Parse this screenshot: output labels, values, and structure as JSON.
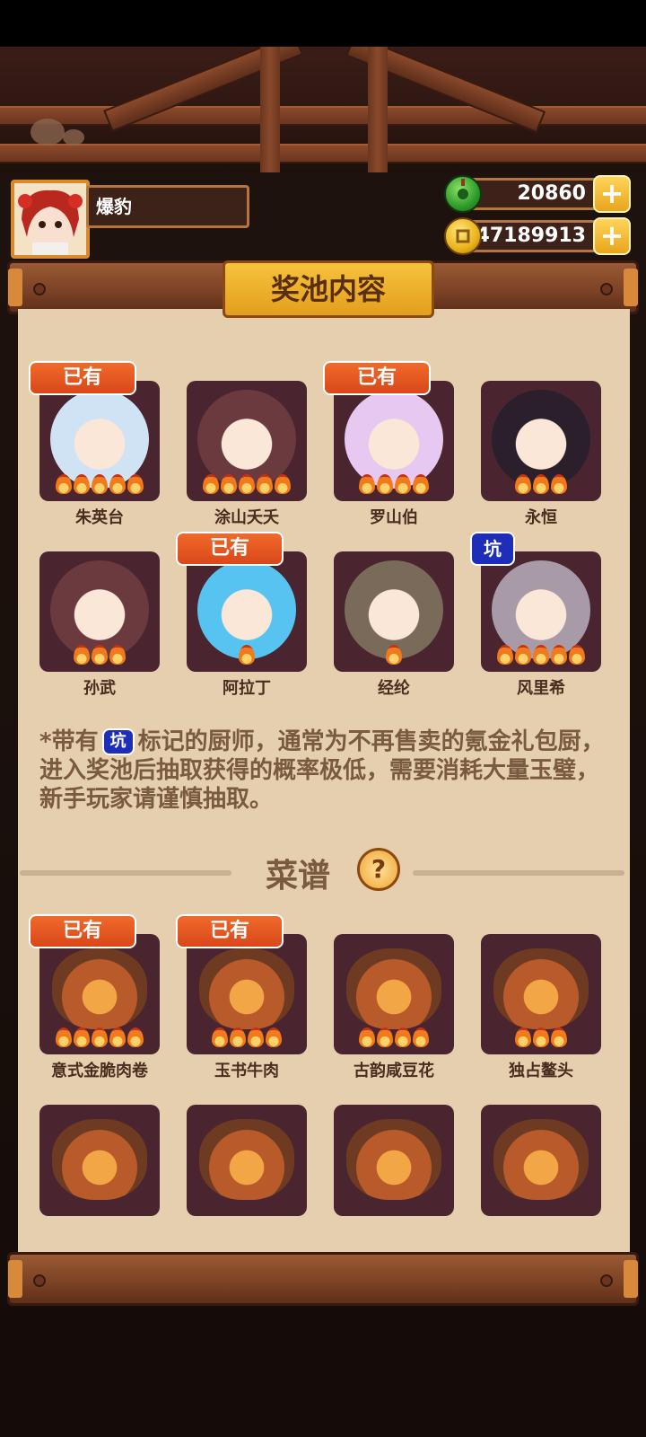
{
  "player": {
    "name": "爆豹"
  },
  "currency": {
    "jade": "20860",
    "coins": "47189913"
  },
  "panel": {
    "title": "奖池内容"
  },
  "chefs": [
    {
      "name": "朱英台",
      "tag": "已有",
      "stars": 5,
      "color": "#cfe3f5"
    },
    {
      "name": "涂山夭夭",
      "tag": "",
      "stars": 5,
      "color": "#6a3a3e"
    },
    {
      "name": "罗山伯",
      "tag": "已有",
      "stars": 4,
      "color": "#e7c8f0"
    },
    {
      "name": "永恒",
      "tag": "",
      "stars": 3,
      "color": "#2a1f2a"
    },
    {
      "name": "孙武",
      "tag": "",
      "stars": 3,
      "color": "#6a3a3e"
    },
    {
      "name": "阿拉丁",
      "tag": "已有",
      "stars": 1,
      "color": "#56c3f0"
    },
    {
      "name": "经纶",
      "tag": "",
      "stars": 1,
      "color": "#7a6a5a"
    },
    {
      "name": "风里希",
      "tag": "坑",
      "stars": 5,
      "color": "#a89aa6"
    }
  ],
  "note": {
    "prefix": "*带有",
    "tag": "坑",
    "text": "标记的厨师，通常为不再售卖的氪金礼包厨，进入奖池后抽取获得的概率极低，需要消耗大量玉璧，新手玩家请谨慎抽取。"
  },
  "recipes_section": {
    "title": "菜谱",
    "help": "?"
  },
  "recipes": [
    {
      "name": "意式金脆肉卷",
      "tag": "已有",
      "stars": 5
    },
    {
      "name": "玉书牛肉",
      "tag": "已有",
      "stars": 4
    },
    {
      "name": "古韵咸豆花",
      "tag": "",
      "stars": 4
    },
    {
      "name": "独占鳌头",
      "tag": "",
      "stars": 3
    },
    {
      "name": "",
      "tag": "",
      "stars": 0
    },
    {
      "name": "",
      "tag": "",
      "stars": 0
    },
    {
      "name": "",
      "tag": "",
      "stars": 0
    },
    {
      "name": "",
      "tag": "",
      "stars": 0
    }
  ],
  "icons": {
    "jade": "jade-coin-icon",
    "coin": "gold-coin-icon",
    "plus": "plus-icon"
  }
}
